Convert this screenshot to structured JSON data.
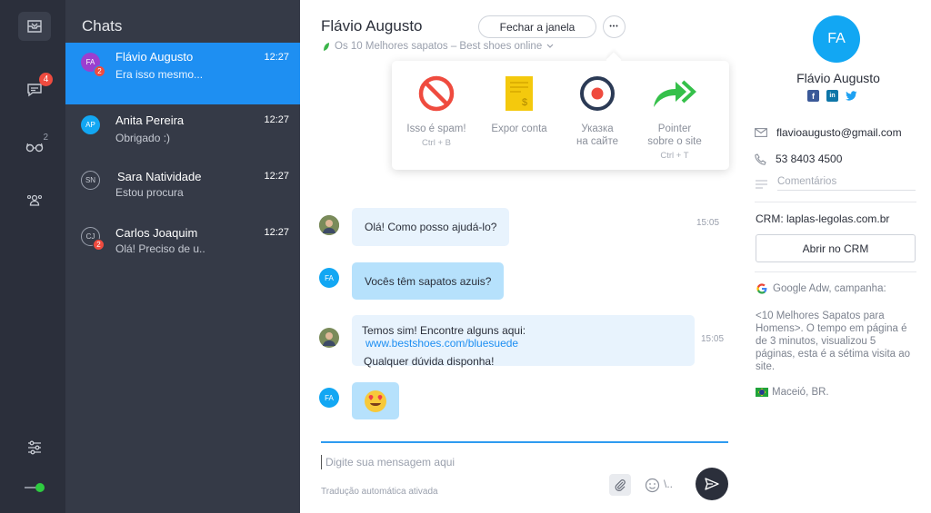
{
  "sidebar": {
    "chats_badge": "4",
    "team_sup": "2"
  },
  "chatlist": {
    "title": "Chats",
    "items": [
      {
        "initials": "FA",
        "name": "Flávio Augusto",
        "time": "12:27",
        "preview": "Era isso mesmo...",
        "badge": "2",
        "avatar_color": "#9b3fcf"
      },
      {
        "initials": "AP",
        "name": "Anita Pereira",
        "time": "12:27",
        "preview": "Obrigado :)",
        "badge": "",
        "avatar_color": "#12a7f3"
      },
      {
        "initials": "SN",
        "name": "Sara Natividade",
        "time": "12:27",
        "preview": "Estou procura",
        "badge": "",
        "avatar_color": "#353a47"
      },
      {
        "initials": "CJ",
        "name": "Carlos Joaquim",
        "time": "12:27",
        "preview": "Olá! Preciso de u..",
        "badge": "2",
        "avatar_color": "#353a47"
      }
    ]
  },
  "main": {
    "contact_name": "Flávio Augusto",
    "close_button": "Fechar a janela",
    "more_button": "•••",
    "subline": "Os 10 Melhores sapatos – Best shoes online",
    "popover": {
      "items": [
        {
          "label": "Isso é spam!",
          "shortcut": "Ctrl + B"
        },
        {
          "label": "Expor conta",
          "shortcut": ""
        },
        {
          "label1": "Указка",
          "label2": "на сайте",
          "shortcut": ""
        },
        {
          "label1": "Pointer",
          "label2": "sobre o site",
          "shortcut": "Ctrl + T"
        }
      ]
    },
    "messages": [
      {
        "text": "Olá! Como posso ajudá-lo?",
        "time": "15:05"
      },
      {
        "initials": "FA",
        "text": "Vocês têm sapatos azuis?"
      },
      {
        "line1_text": "Temos sim! Encontre alguns aqui:",
        "link": "www.bestshoes.com/bluesuede",
        "line2": "Qualquer dúvida disponha!",
        "time": "15:05"
      },
      {
        "initials": "FA",
        "emoji": "😍"
      }
    ],
    "composer": {
      "placeholder": "Digite sua mensagem aqui",
      "auto_translate": "Tradução automática ativada",
      "slash": "\\.."
    }
  },
  "profile": {
    "initials": "FA",
    "name": "Flávio Augusto",
    "email": "flavioaugusto@gmail.com",
    "phone": "53 8403 4500",
    "notes_placeholder": "Comentários",
    "crm_label": "CRM: laplas-legolas.com.br",
    "crm_button": "Abrir no CRM",
    "campaign_label": "Google Adw, campanha:",
    "campaign_text": "<10 Melhores Sapatos para Homens>. O tempo em página é de 3 minutos, visualizou 5 páginas, esta é a sétima visita ao site.",
    "location": "Maceió, BR."
  },
  "colors": {
    "accent": "#1e8ff2",
    "rail": "#2b2f3b",
    "list": "#353a47",
    "badge": "#ef4b3f",
    "online": "#2ecc40"
  }
}
